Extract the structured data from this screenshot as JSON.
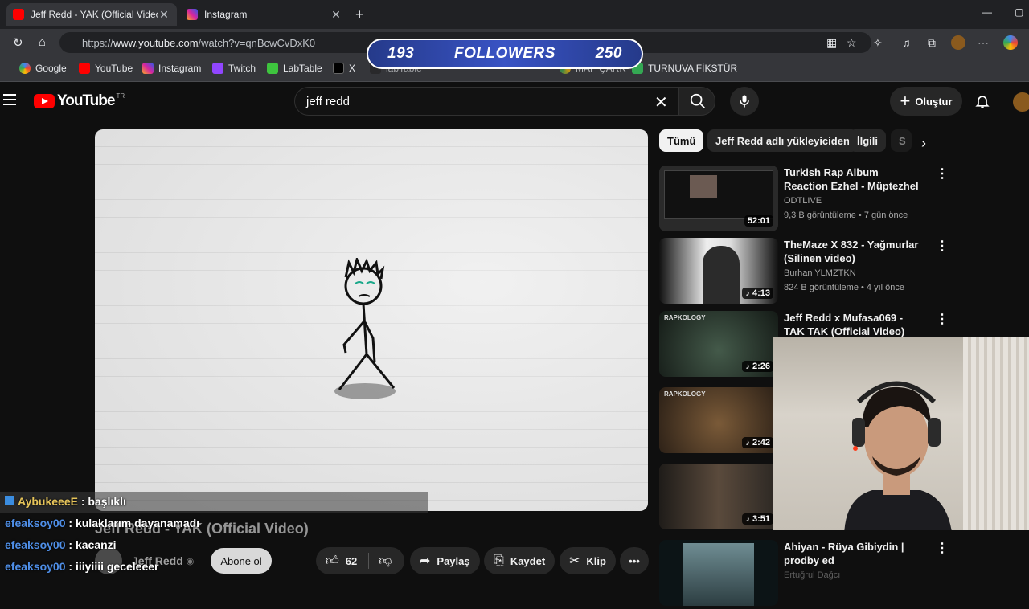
{
  "browser": {
    "tabs": [
      {
        "title": "Jeff Redd - YAK (Official Video) - Y",
        "active": true,
        "favicon_color": "#ff0000"
      },
      {
        "title": "Instagram",
        "active": false,
        "favicon_color": "#d6249f"
      }
    ],
    "url_prefix": "https://",
    "url_host": "www.youtube.com",
    "url_path": "/watch?v=qnBcwCvDxK0",
    "bookmarks": [
      "Google",
      "YouTube",
      "Instagram",
      "Twitch",
      "LabTable",
      "X",
      "labTable",
      "MAP ÇARK",
      "TURNUVA FİKSTÜR"
    ]
  },
  "overlay": {
    "followers_current": "193",
    "followers_label": "FOLLOWERS",
    "followers_goal": "250"
  },
  "youtube": {
    "logo_text": "YouTube",
    "region": "TR",
    "search_query": "jeff redd",
    "create_label": "Oluştur",
    "video_title": "Jeff Redd - YAK (Official Video)",
    "channel_name": "Jeff Redd",
    "subscribe_label": "Abone ol",
    "like_count": "62",
    "share_label": "Paylaş",
    "save_label": "Kaydet",
    "clip_label": "Klip",
    "chips": [
      "Tümü",
      "Jeff Redd adlı yükleyiciden",
      "İlgili",
      "S"
    ],
    "recommendations": [
      {
        "title": "Turkish Rap Album Reaction Ezhel - Müptezhel",
        "channel": "ODTLIVE",
        "meta": "9,3 B görüntüleme • 7 gün önce",
        "duration": "52:01",
        "thumb_color": "#2a2a2a"
      },
      {
        "title": "TheMaze X 832 - Yağmurlar (Silinen video)",
        "channel": "Burhan YLMZTKN",
        "meta": "824 B görüntüleme • 4 yıl önce",
        "duration": "4:13",
        "thumb_color": "#d0d0d0"
      },
      {
        "title": "Jeff Redd x Mufasa069 - TAK TAK (Official Video)",
        "channel": "",
        "meta": "",
        "duration": "2:26",
        "thumb_color": "#1e2a22"
      },
      {
        "title": "",
        "channel": "",
        "meta": "",
        "duration": "2:42",
        "thumb_color": "#4a3a28"
      },
      {
        "title": "",
        "channel": "",
        "meta": "",
        "duration": "3:51",
        "thumb_color": "#2b2723"
      },
      {
        "title": "Ahiyan - Rüya Gibiydin | prodby ed",
        "channel": "Ertuğrul Dağcı",
        "meta": "",
        "duration": "",
        "thumb_color": "#3a5058"
      }
    ]
  },
  "chat": [
    {
      "user": "AybukeeeE",
      "message": "başlıklı"
    },
    {
      "user": "efeaksoy00",
      "message": "kulaklarım dayanamadı"
    },
    {
      "user": "efeaksoy00",
      "message": "kacanzi"
    },
    {
      "user": "efeaksoy00",
      "message": "iiiyiiii geceleeer"
    }
  ]
}
